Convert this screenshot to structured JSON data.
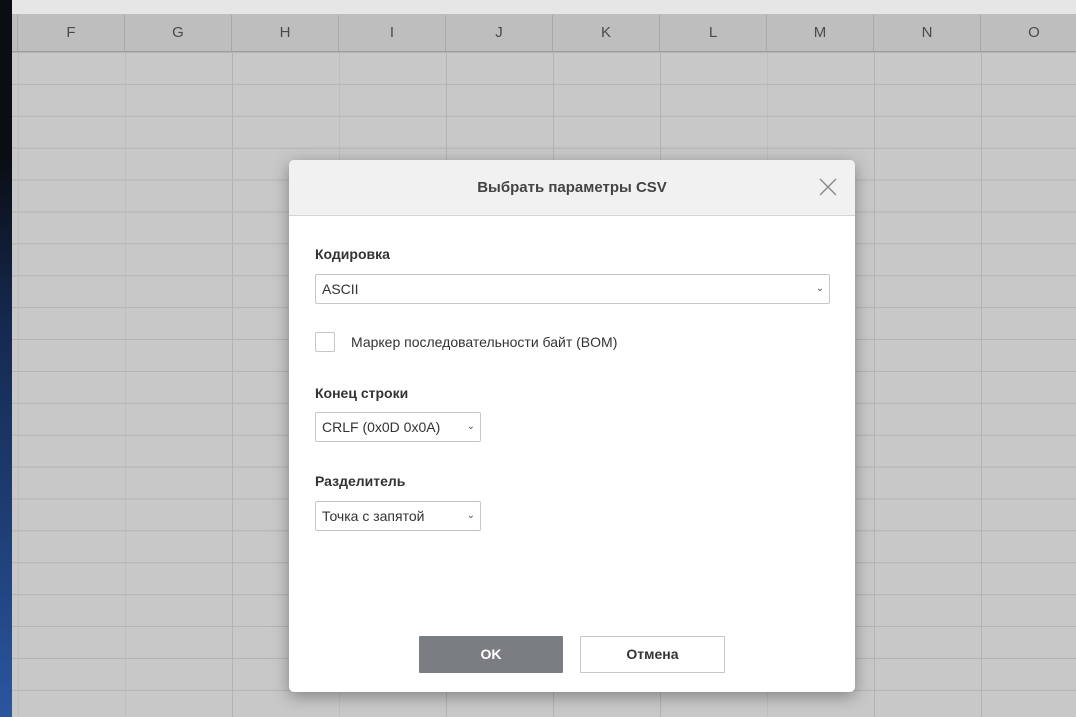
{
  "columns": [
    "F",
    "G",
    "H",
    "I",
    "J",
    "K",
    "L",
    "M",
    "N",
    "O"
  ],
  "dialog": {
    "title": "Выбрать параметры CSV",
    "encoding": {
      "label": "Кодировка",
      "value": "ASCII"
    },
    "bom": {
      "label": "Маркер последовательности байт (BOM)",
      "checked": false
    },
    "line_end": {
      "label": "Конец строки",
      "value": "CRLF (0x0D 0x0A)"
    },
    "delimiter": {
      "label": "Разделитель",
      "value": "Точка с запятой"
    },
    "ok_label": "OK",
    "cancel_label": "Отмена"
  },
  "icons": {
    "close": "close-icon",
    "dropdown": "chevron-down-icon"
  }
}
